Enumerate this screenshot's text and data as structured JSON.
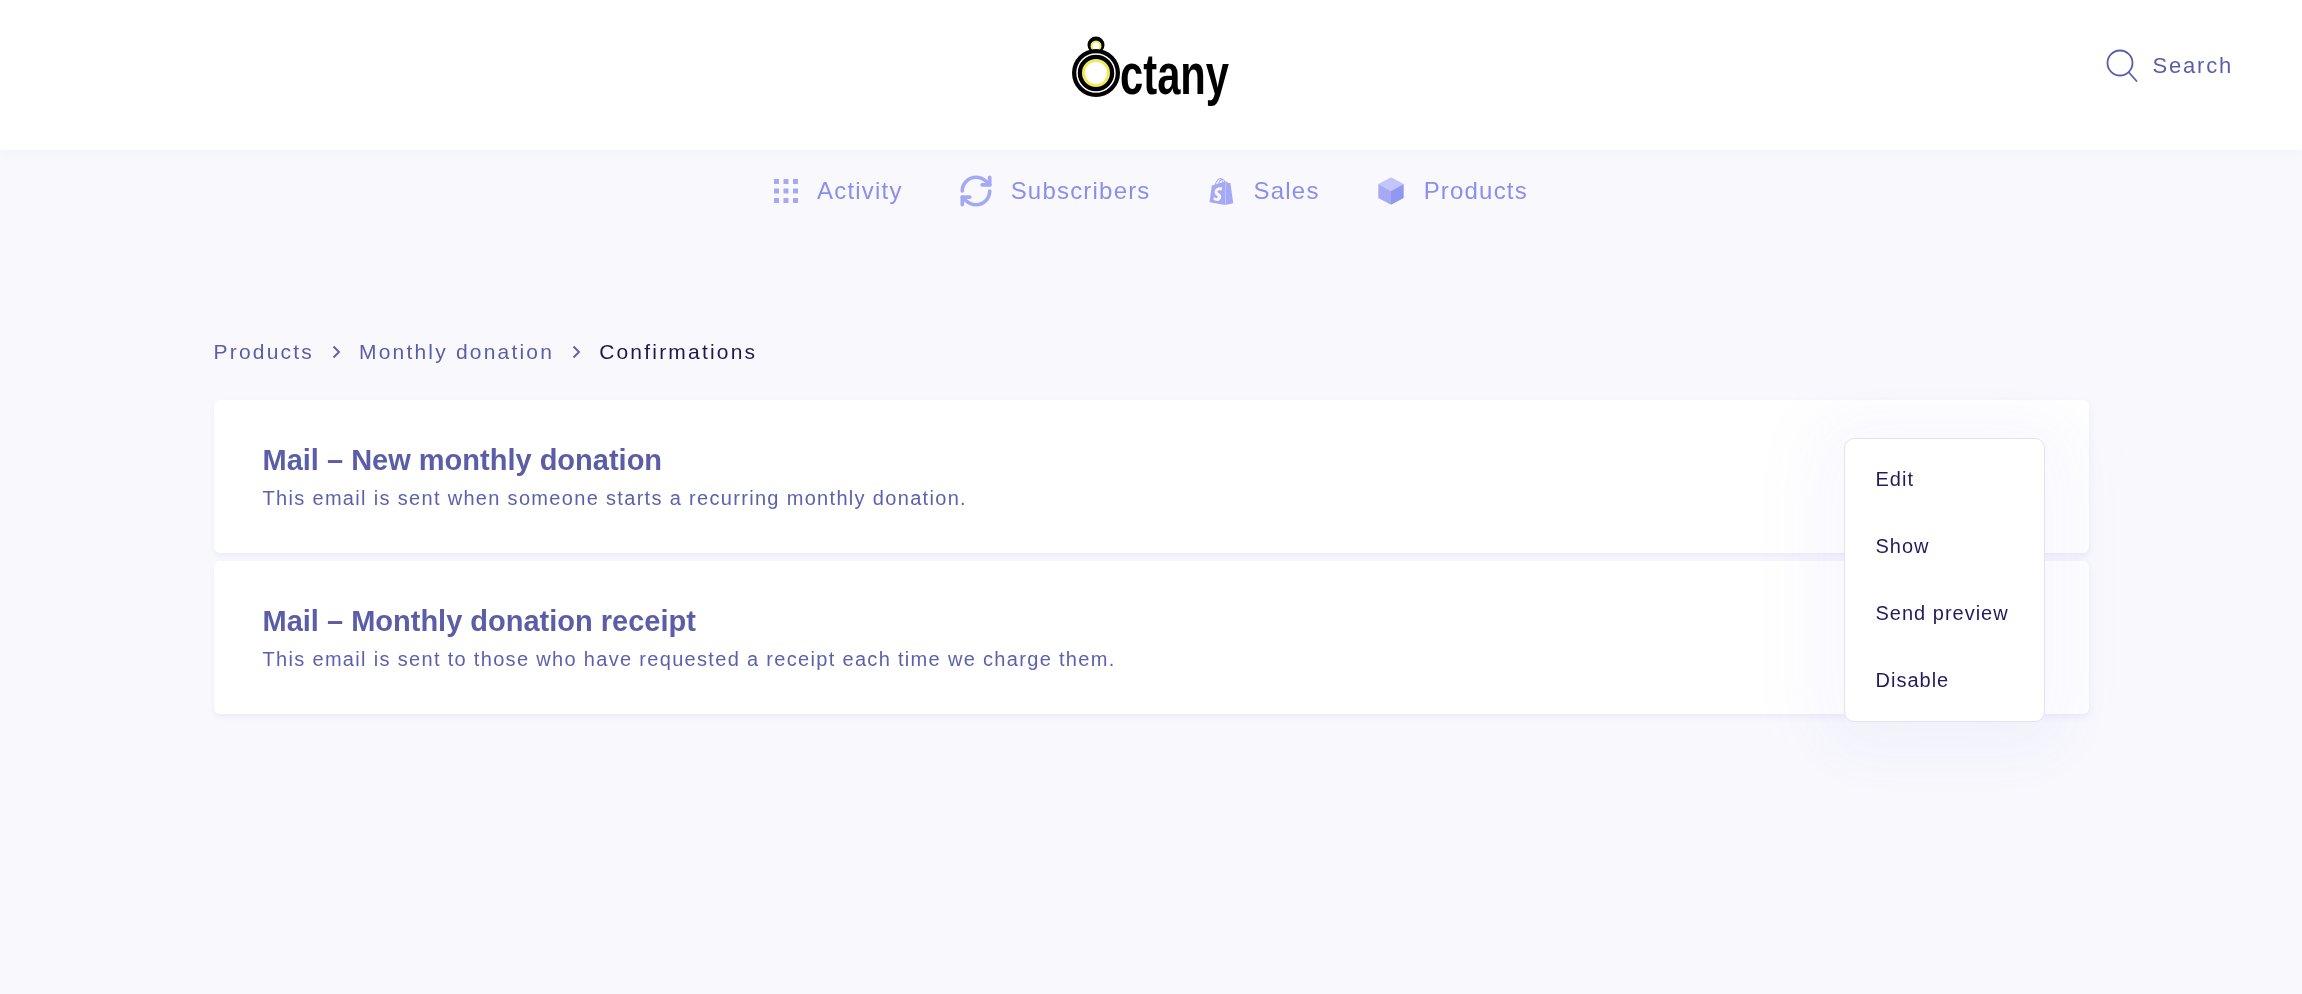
{
  "header": {
    "logo": {
      "wordmark": "ctany"
    },
    "search": {
      "label": "Search"
    }
  },
  "nav": {
    "items": [
      {
        "label": "Activity"
      },
      {
        "label": "Subscribers"
      },
      {
        "label": "Sales"
      },
      {
        "label": "Products"
      }
    ]
  },
  "breadcrumb": [
    {
      "label": "Products",
      "current": false
    },
    {
      "label": "Monthly donation",
      "current": false
    },
    {
      "label": "Confirmations",
      "current": true
    }
  ],
  "emails": [
    {
      "title": "Mail – New monthly donation",
      "description": "This email is sent when someone starts a recurring monthly donation."
    },
    {
      "title": "Mail – Monthly donation receipt",
      "description": "This email is sent to those who have requested a receipt each time we charge them."
    }
  ],
  "action_menu": {
    "items": [
      {
        "label": "Edit"
      },
      {
        "label": "Show"
      },
      {
        "label": "Send preview"
      },
      {
        "label": "Disable"
      }
    ]
  }
}
